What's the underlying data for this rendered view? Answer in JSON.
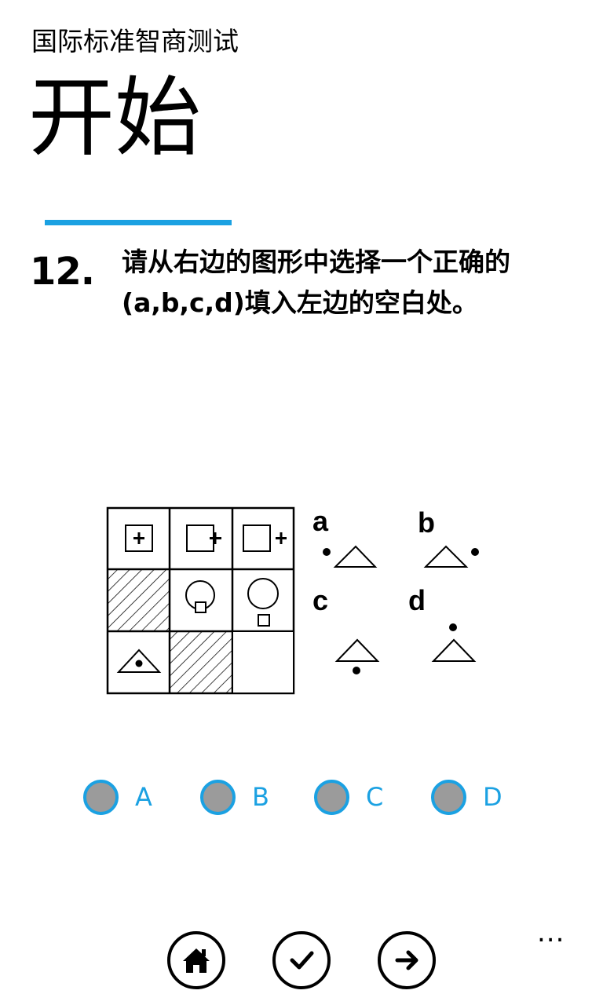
{
  "app_title": "国际标准智商测试",
  "page_title": "开始",
  "question": {
    "number": "12.",
    "text": "请从右边的图形中选择一个正确的(a,b,c,d)填入左边的空白处。"
  },
  "puzzle": {
    "option_letters": [
      "a",
      "b",
      "c",
      "d"
    ]
  },
  "answers": [
    {
      "label": "A"
    },
    {
      "label": "B"
    },
    {
      "label": "C"
    },
    {
      "label": "D"
    }
  ],
  "app_bar": {
    "buttons": [
      "home-icon",
      "check-icon",
      "arrow-right-icon"
    ],
    "more_label": "..."
  },
  "colors": {
    "accent": "#1BA1E2",
    "radio_fill": "#9B9B9B",
    "text": "#000000",
    "background": "#FFFFFF"
  }
}
